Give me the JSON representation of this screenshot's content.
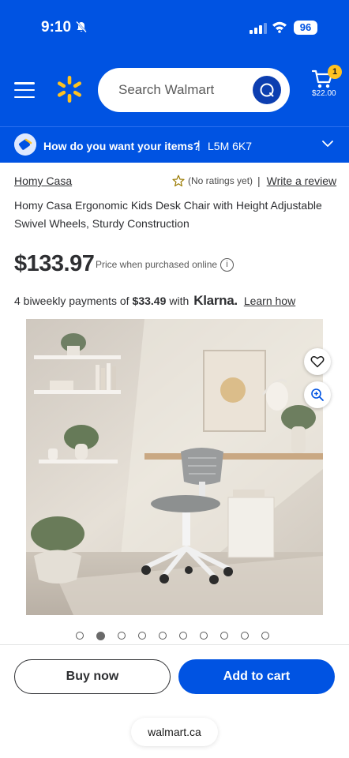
{
  "status_bar": {
    "time": "9:10",
    "battery": "96"
  },
  "header": {
    "search": {
      "placeholder": "Search Walmart"
    },
    "cart": {
      "badge": "1",
      "total": "$22.00"
    }
  },
  "fulfillment": {
    "question": "How do you want your items?",
    "divider": "|",
    "postal_code": "L5M 6K7"
  },
  "product": {
    "brand": "Homy Casa",
    "rating_text": "(No ratings yet)",
    "rating_separator": "|",
    "write_review": "Write a review",
    "title": "Homy Casa Ergonomic Kids Desk Chair with Height Adjustable Swivel Wheels, Sturdy Construction",
    "price": "$133.97",
    "price_note": "Price when purchased online",
    "installments": {
      "prefix": "4 biweekly payments of",
      "amount": "$33.49",
      "with": "with",
      "provider": "Klarna.",
      "learn_how": "Learn how"
    }
  },
  "carousel": {
    "count": 10,
    "active_index": 1
  },
  "actions": {
    "buy_now": "Buy now",
    "add_to_cart": "Add to cart"
  },
  "browser": {
    "url": "walmart.ca"
  },
  "colors": {
    "brand_blue": "#0053e2",
    "spark_yellow": "#ffc220"
  }
}
